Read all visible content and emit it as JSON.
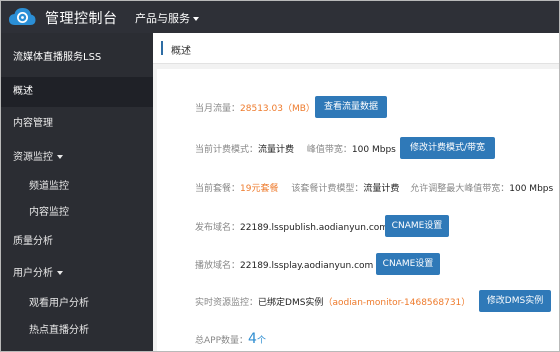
{
  "header": {
    "brand": "管理控制台",
    "products_menu": "产品与服务"
  },
  "sidebar": {
    "title": "流媒体直播服务LSS",
    "items": [
      {
        "label": "概述"
      },
      {
        "label": "内容管理"
      },
      {
        "label": "资源监控"
      },
      {
        "label": "频道监控"
      },
      {
        "label": "内容监控"
      },
      {
        "label": "质量分析"
      },
      {
        "label": "用户分析"
      },
      {
        "label": "观看用户分析"
      },
      {
        "label": "热点直播分析"
      }
    ]
  },
  "main": {
    "breadcrumb": "概述",
    "traffic": {
      "label": "当月流量：",
      "value": "28513.03（MB）",
      "button": "查看流量数据"
    },
    "billing": {
      "label": "当前计费模式：",
      "value": "流量计费",
      "peak_label": "峰值带宽：",
      "peak_value": "100 Mbps",
      "button": "修改计费模式/带宽"
    },
    "package": {
      "label": "当前套餐：",
      "value": "19元套餐",
      "model_label": "该套餐计费模型：",
      "model_value": "流量计费",
      "max_label": "允许调整最大峰值带宽：",
      "max_value": "100 Mbps"
    },
    "publish": {
      "label": "发布域名：",
      "value": "22189.lsspublish.aodianyun.com",
      "button": "CNAME设置"
    },
    "play": {
      "label": "播放域名：",
      "value": "22189.lssplay.aodianyun.com",
      "button": "CNAME设置"
    },
    "monitor": {
      "label": "实时资源监控：",
      "value": "已绑定DMS实例",
      "instance": "（aodian-monitor-1468568731）",
      "button": "修改DMS实例"
    },
    "apps": {
      "label": "总APP数量：",
      "count": "4",
      "unit": "个"
    }
  }
}
